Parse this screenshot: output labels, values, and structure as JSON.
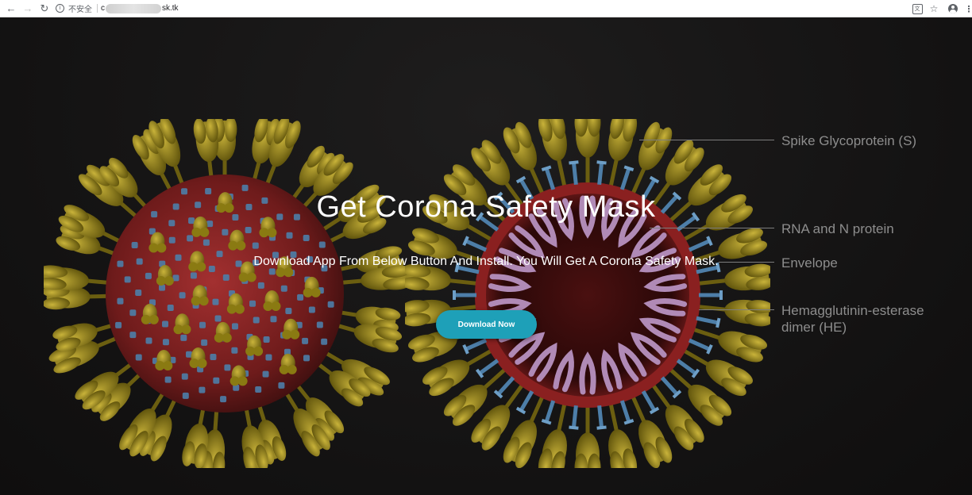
{
  "browser": {
    "back_icon": "arrow-left-icon",
    "forward_icon": "arrow-right-icon",
    "reload_icon": "reload-icon",
    "security_label": "不安全",
    "url_start": "c",
    "url_end": "sk.tk",
    "translate_icon": "translate-icon",
    "bookmark_icon": "star-icon",
    "profile_icon": "account-icon",
    "menu_icon": "more-vert-icon"
  },
  "hero": {
    "title": "Get Corona Safety Mask",
    "subtitle": "Download App From Below Button And Install. You Will Get A Corona Safety Mask.",
    "download_button": "Download Now",
    "button_color": "#1ea0b8"
  },
  "diagram": {
    "labels": {
      "spike": "Spike Glycoprotein (S)",
      "rna": "RNA and N protein",
      "envelope": "Envelope",
      "he_line1": "Hemagglutinin-esterase",
      "he_line2": "dimer (HE)"
    },
    "colors": {
      "spike": "#8a7a12",
      "body": "#7a1d1d",
      "protein": "#4d7ea8",
      "rna": "#b08ab6"
    }
  }
}
